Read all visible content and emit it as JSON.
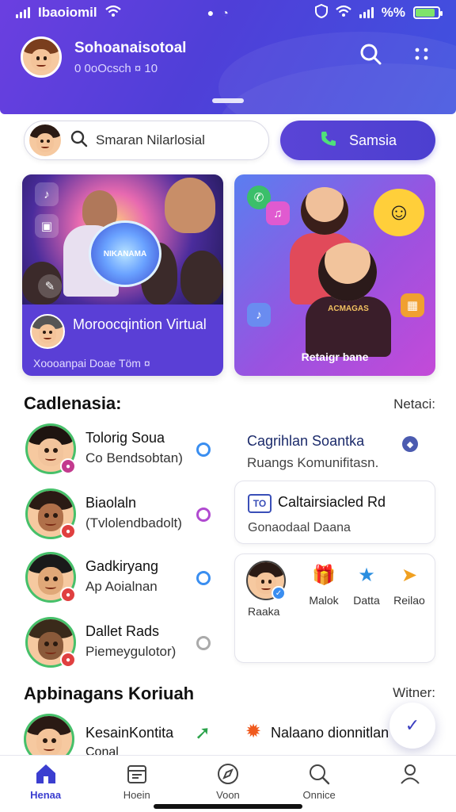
{
  "status_bar": {
    "carrier": "Ibaoiomil",
    "right_label": "%%",
    "battery_level": 0.85
  },
  "header": {
    "profile_name": "Sohoanaisotoal",
    "profile_sub": "0 0oOcsch ¤ 10",
    "search_icon": "search-icon",
    "more_icon": "grid-dots-icon"
  },
  "search_row": {
    "search_text": "Smaran Nilarlosial",
    "call_label": "Samsia"
  },
  "feature_cards": {
    "left": {
      "orb_text": "NIKANAMA",
      "title": "Moroocqintion Virtual",
      "subtitle": "Xoooanpai Doae Töm ¤"
    },
    "right": {
      "shirt_text": "ACMAGAS",
      "footer": "Retaigr bane"
    }
  },
  "contacts_section": {
    "heading": "Cadlenasia:",
    "link": "Netaci:",
    "contacts": [
      {
        "name": "Tolorig Soua",
        "status": "Co Bendsobtan)",
        "badge_color": "#c33a8e",
        "ring_color": "#3a8ef0"
      },
      {
        "name": "Biaolaln",
        "status": "(Tvlolendbadolt)",
        "badge_color": "#e04040",
        "ring_color": "#b04ad0"
      },
      {
        "name": "Gadkiryang",
        "status": "Ap Aoialnan",
        "badge_color": "#e04040",
        "ring_color": "#3a8ef0"
      },
      {
        "name": "Dallet Rads",
        "status": "Piemeygulotor)",
        "badge_color": "#e04040",
        "ring_color": "#aaaaaa"
      }
    ]
  },
  "right_column": {
    "title": "Cagrihlan Soantka",
    "subtitle": "Ruangs Komunifitasn.",
    "card_one": {
      "chip": "TO",
      "title": "Caltairsiacled Rd",
      "subtitle": "Gonaodaal Daana"
    },
    "card_two": {
      "avatar_label": "Raaka",
      "actions": [
        {
          "label": "Malok",
          "icon": "gift-icon",
          "glyph": "🎁"
        },
        {
          "label": "Datta",
          "icon": "star-icon",
          "glyph": "★"
        },
        {
          "label": "Reilao",
          "icon": "send-icon",
          "glyph": "➤"
        }
      ]
    }
  },
  "bottom_section": {
    "heading": "Apbinagans Koriuah",
    "link": "Witner:",
    "item_title": "KesainKontita",
    "item_sub": "Conal",
    "item_title_2": "Nalaano dionnitlan"
  },
  "bottom_nav": [
    {
      "label": "Henaa",
      "icon": "home-icon",
      "active": true
    },
    {
      "label": "Hoein",
      "icon": "calendar-icon",
      "active": false
    },
    {
      "label": "Voon",
      "icon": "compass-icon",
      "active": false
    },
    {
      "label": "Onnice",
      "icon": "search-icon",
      "active": false
    },
    {
      "label": "",
      "icon": "profile-icon",
      "active": false
    }
  ],
  "colors": {
    "accent": "#4c3fd0",
    "online_ring": "#46c06a"
  }
}
